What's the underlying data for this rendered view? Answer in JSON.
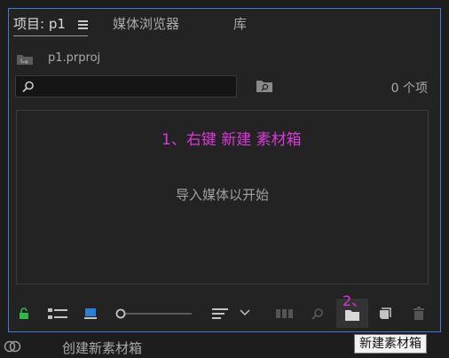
{
  "tabs": [
    {
      "label": "项目: p1"
    },
    {
      "label": "媒体浏览器"
    },
    {
      "label": "库"
    }
  ],
  "project": {
    "file_name": "p1.prproj"
  },
  "search": {
    "placeholder": ""
  },
  "item_count": "0 个项",
  "annotation_1": "1、右键 新建 素材箱",
  "empty_message": "导入媒体以开始",
  "annotation_2": "2、",
  "tooltip": "新建素材箱",
  "status_text": "创建新素材箱",
  "colors": {
    "accent": "#3f7ad6",
    "annotation": "#d83ad6",
    "lock_green": "#2db84a",
    "freeform_blue": "#2d7fd6"
  }
}
